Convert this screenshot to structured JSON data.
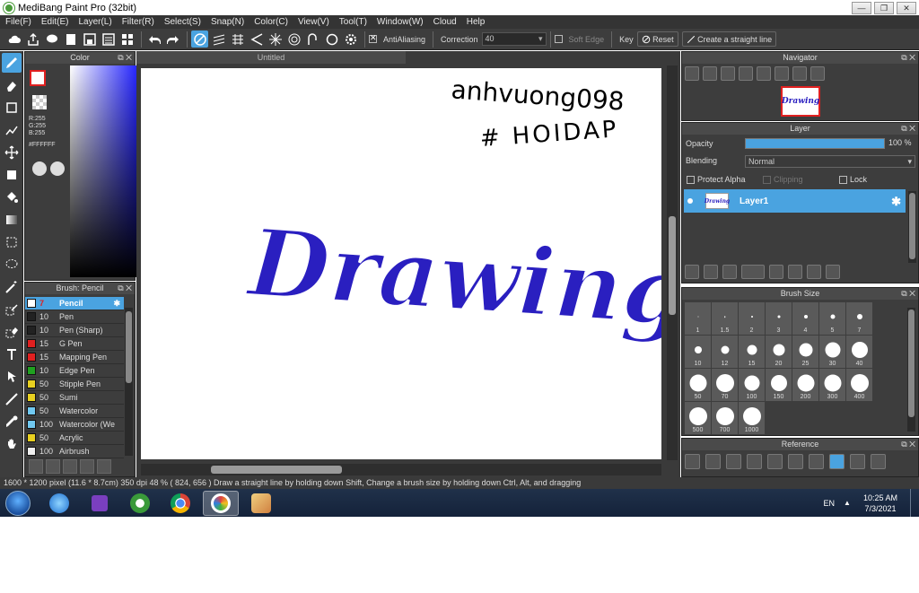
{
  "window": {
    "title": "MediBang Paint Pro (32bit)"
  },
  "menu": [
    "File(F)",
    "Edit(E)",
    "Layer(L)",
    "Filter(R)",
    "Select(S)",
    "Snap(N)",
    "Color(C)",
    "View(V)",
    "Tool(T)",
    "Window(W)",
    "Cloud",
    "Help"
  ],
  "toolbar": {
    "antialiasing": "AntiAliasing",
    "correction_label": "Correction",
    "correction_value": "40",
    "soft_edge": "Soft Edge",
    "key_label": "Key",
    "reset": "Reset",
    "create_line": "Create a straight line"
  },
  "color_panel": {
    "title": "Color",
    "r": "R:255",
    "g": "G:255",
    "b": "B:255",
    "hex": "#FFFFFF"
  },
  "brush_panel": {
    "title": "Brush: Pencil",
    "items": [
      {
        "size": "7",
        "name": "Pencil",
        "color": "#ffffff"
      },
      {
        "size": "10",
        "name": "Pen",
        "color": "#222222"
      },
      {
        "size": "10",
        "name": "Pen (Sharp)",
        "color": "#222222"
      },
      {
        "size": "15",
        "name": "G Pen",
        "color": "#e02020"
      },
      {
        "size": "15",
        "name": "Mapping Pen",
        "color": "#e02020"
      },
      {
        "size": "10",
        "name": "Edge Pen",
        "color": "#20a020"
      },
      {
        "size": "50",
        "name": "Stipple Pen",
        "color": "#e8d020"
      },
      {
        "size": "50",
        "name": "Sumi",
        "color": "#e8d020"
      },
      {
        "size": "50",
        "name": "Watercolor",
        "color": "#70c8f0"
      },
      {
        "size": "100",
        "name": "Watercolor (We",
        "color": "#70c8f0"
      },
      {
        "size": "50",
        "name": "Acrylic",
        "color": "#e8d020"
      },
      {
        "size": "100",
        "name": "Airbrush",
        "color": "#eeeeee"
      }
    ]
  },
  "canvas": {
    "tab": "Untitled",
    "handwriting_line1": "anhvuong098",
    "handwriting_line2": "# HOIDAP",
    "drawing_text": "Drawing"
  },
  "navigator": {
    "title": "Navigator",
    "thumb_text": "Drawing"
  },
  "layer_panel": {
    "title": "Layer",
    "opacity_label": "Opacity",
    "opacity_value": "100 %",
    "opacity_fraction": 1.0,
    "blending_label": "Blending",
    "blending_value": "Normal",
    "protect_alpha": "Protect Alpha",
    "clipping": "Clipping",
    "lock": "Lock",
    "layer_name": "Layer1"
  },
  "brush_size": {
    "title": "Brush Size",
    "sizes": [
      "1",
      "1.5",
      "2",
      "3",
      "4",
      "5",
      "7",
      "10",
      "12",
      "15",
      "20",
      "25",
      "30",
      "40",
      "50",
      "70",
      "100",
      "150",
      "200",
      "300",
      "400",
      "500",
      "700",
      "1000"
    ]
  },
  "reference": {
    "title": "Reference"
  },
  "status": {
    "text": "1600 * 1200 pixel  (11.6 * 8.7cm)  350 dpi  48 %  ( 824, 656 )  Draw a straight line by holding down Shift, Change a brush size by holding down Ctrl, Alt, and dragging"
  },
  "taskbar": {
    "lang": "EN",
    "time": "10:25 AM",
    "date": "7/3/2021"
  },
  "colors": {
    "accent": "#4aa3e0",
    "ink": "#2a1fc0",
    "panel": "#3d3d3d"
  }
}
